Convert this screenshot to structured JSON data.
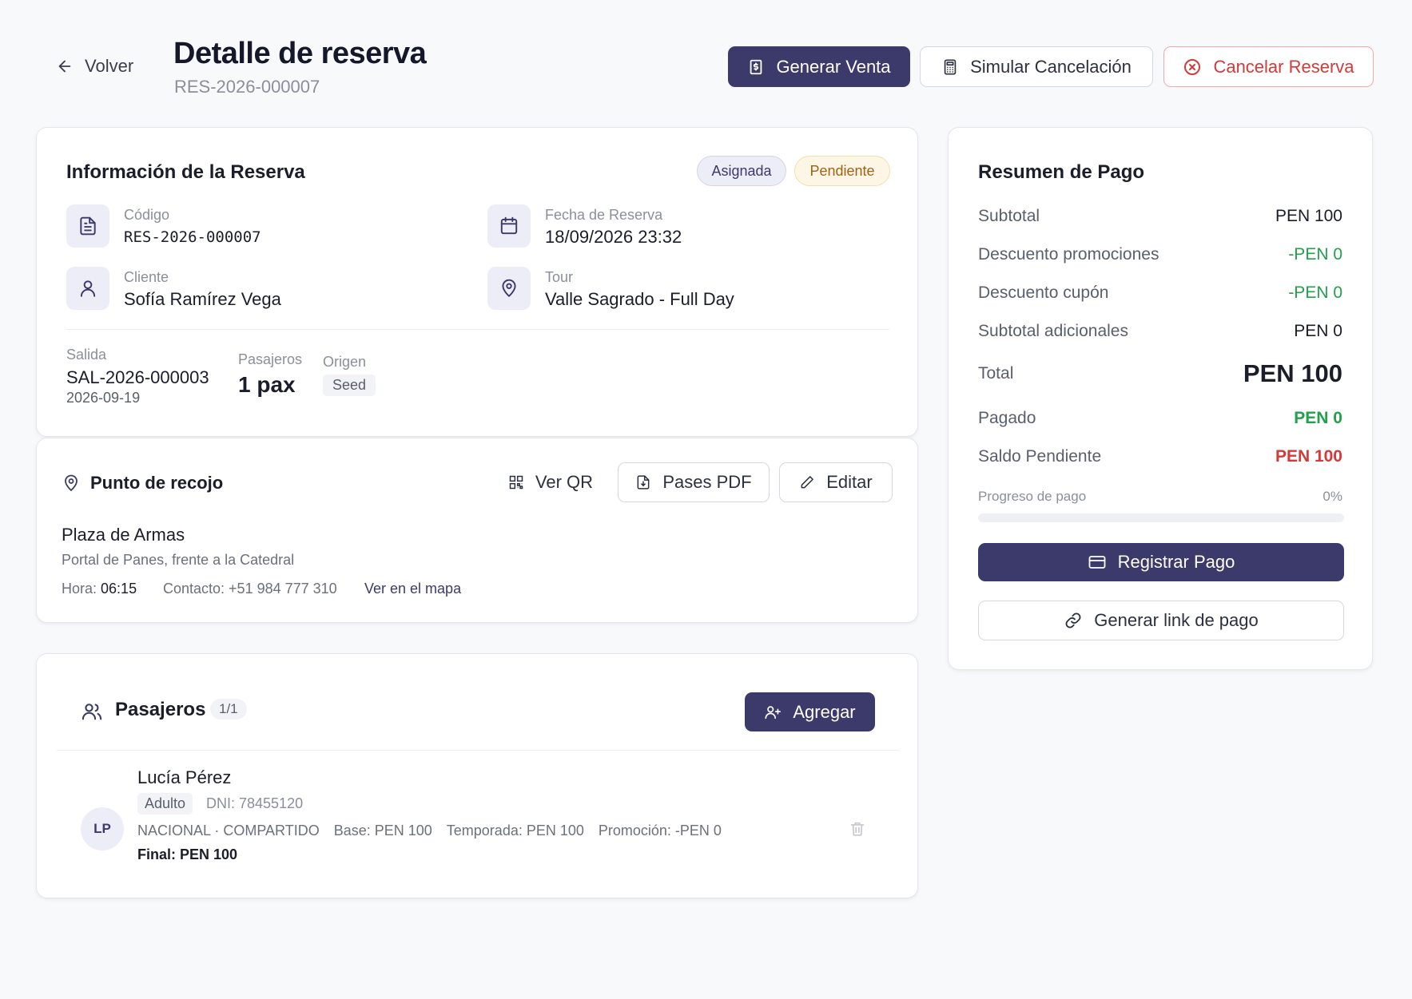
{
  "header": {
    "back_label": "Volver",
    "title": "Detalle de reserva",
    "code": "RES-2026-000007",
    "actions": {
      "generate_sale": "Generar Venta",
      "simulate_cancel": "Simular Cancelación",
      "cancel_reservation": "Cancelar Reserva"
    }
  },
  "reservation_info": {
    "title": "Información de la Reserva",
    "badges": {
      "assigned": "Asignada",
      "pending": "Pendiente"
    },
    "code_label": "Código",
    "code_value": "RES-2026-000007",
    "date_label": "Fecha de Reserva",
    "date_value": "18/09/2026 23:32",
    "client_label": "Cliente",
    "client_value": "Sofía Ramírez Vega",
    "tour_label": "Tour",
    "tour_value": "Valle Sagrado - Full Day",
    "departure_label": "Salida",
    "departure_code": "SAL-2026-000003",
    "departure_date": "2026-09-19",
    "passengers_label": "Pasajeros",
    "passengers_value": "1 pax",
    "origin_label": "Origen",
    "origin_value": "Seed"
  },
  "pickup": {
    "title": "Punto de recojo",
    "qr_label": "Ver QR",
    "pdf_label": "Pases PDF",
    "edit_label": "Editar",
    "place": "Plaza de Armas",
    "address": "Portal de Panes, frente a la Catedral",
    "time_label": "Hora:",
    "time_value": "06:15",
    "contact": "Contacto: +51 984 777 310",
    "map_link": "Ver en el mapa"
  },
  "passengers": {
    "title": "Pasajeros",
    "count": "1/1",
    "add_label": "Agregar",
    "items": [
      {
        "initials": "LP",
        "name": "Lucía Pérez",
        "type": "Adulto",
        "dni": "DNI: 78455120",
        "category": "NACIONAL · COMPARTIDO",
        "base": "Base: PEN 100",
        "season": "Temporada: PEN 100",
        "promo": "Promoción: -PEN 0",
        "final": "Final: PEN 100"
      }
    ]
  },
  "payment": {
    "title": "Resumen de Pago",
    "subtotal_label": "Subtotal",
    "subtotal_value": "PEN 100",
    "promo_discount_label": "Descuento promociones",
    "promo_discount_value": "-PEN 0",
    "coupon_discount_label": "Descuento cupón",
    "coupon_discount_value": "-PEN 0",
    "extras_label": "Subtotal adicionales",
    "extras_value": "PEN 0",
    "total_label": "Total",
    "total_value": "PEN 100",
    "paid_label": "Pagado",
    "paid_value": "PEN 0",
    "balance_label": "Saldo Pendiente",
    "balance_value": "PEN 100",
    "progress_label": "Progreso de pago",
    "progress_text": "0%",
    "progress_fraction": 0,
    "register_label": "Registrar Pago",
    "link_label": "Generar link de pago"
  },
  "colors": {
    "primary": "#3b3a6b",
    "success": "#22a04b",
    "danger": "#d33a3a",
    "pending_badge": "#fdf6e4",
    "assigned_badge": "#ededf7"
  }
}
